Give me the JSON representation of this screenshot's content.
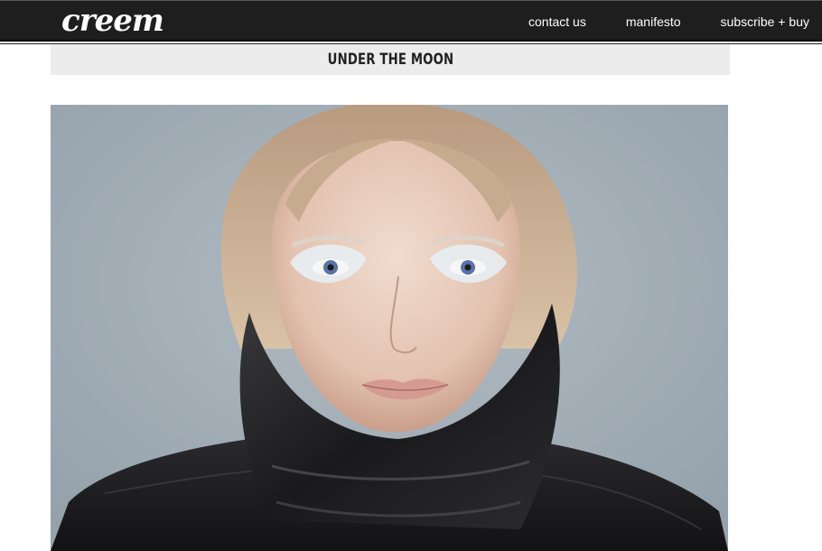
{
  "header": {
    "logo_text": "creem",
    "nav": [
      {
        "label": "contact us"
      },
      {
        "label": "manifesto"
      },
      {
        "label": "subscribe + buy"
      }
    ]
  },
  "article": {
    "title": "UNDER THE MOON"
  },
  "colors": {
    "topbar": "#1e1e1e",
    "title_bar": "#ececec",
    "photo_background": "#a3afb8"
  }
}
